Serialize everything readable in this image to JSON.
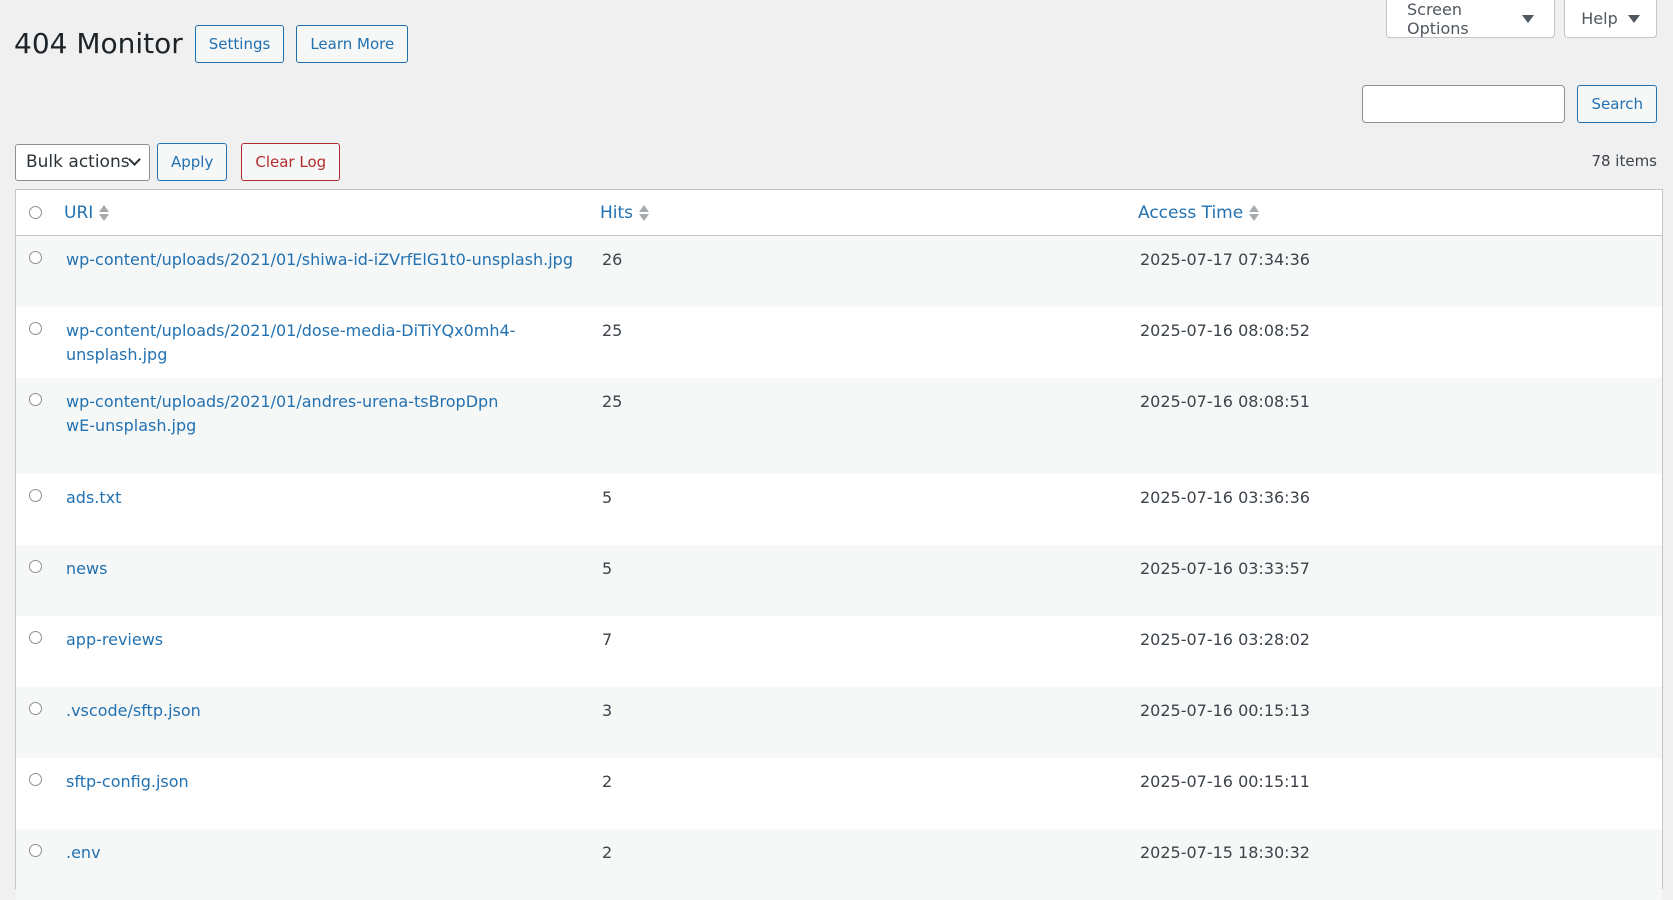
{
  "screen_meta": {
    "screen_options_label": "Screen Options",
    "help_label": "Help"
  },
  "header": {
    "title": "404 Monitor",
    "settings_label": "Settings",
    "learn_more_label": "Learn More"
  },
  "search": {
    "value": "",
    "button_label": "Search"
  },
  "tablenav": {
    "bulk_actions_label": "Bulk actions",
    "apply_label": "Apply",
    "clear_log_label": "Clear Log",
    "items_count": "78 items"
  },
  "table": {
    "columns": {
      "uri": "URI",
      "hits": "Hits",
      "access_time": "Access Time"
    },
    "rows": [
      {
        "uri": "wp-content/uploads/2021/01/shiwa-id-iZVrfElG1t0-unsplash.jpg",
        "hits": "26",
        "time": "2025-07-17 07:34:36"
      },
      {
        "uri": "wp-content/uploads/2021/01/dose-media-DiTiYQx0mh4-unsplash.jpg",
        "hits": "25",
        "time": "2025-07-16 08:08:52"
      },
      {
        "uri": "wp-content/uploads/2021/01/andres-urena-tsBropDpnwE-unsplash.jpg",
        "hits": "25",
        "time": "2025-07-16 08:08:51"
      },
      {
        "uri": "ads.txt",
        "hits": "5",
        "time": "2025-07-16 03:36:36"
      },
      {
        "uri": "news",
        "hits": "5",
        "time": "2025-07-16 03:33:57"
      },
      {
        "uri": "app-reviews",
        "hits": "7",
        "time": "2025-07-16 03:28:02"
      },
      {
        "uri": ".vscode/sftp.json",
        "hits": "3",
        "time": "2025-07-16 00:15:13"
      },
      {
        "uri": "sftp-config.json",
        "hits": "2",
        "time": "2025-07-16 00:15:11"
      },
      {
        "uri": ".env",
        "hits": "2",
        "time": "2025-07-15 18:30:32"
      }
    ]
  },
  "colors": {
    "accent": "#2271b1",
    "danger": "#b32d2e",
    "background": "#f0f0f1"
  }
}
